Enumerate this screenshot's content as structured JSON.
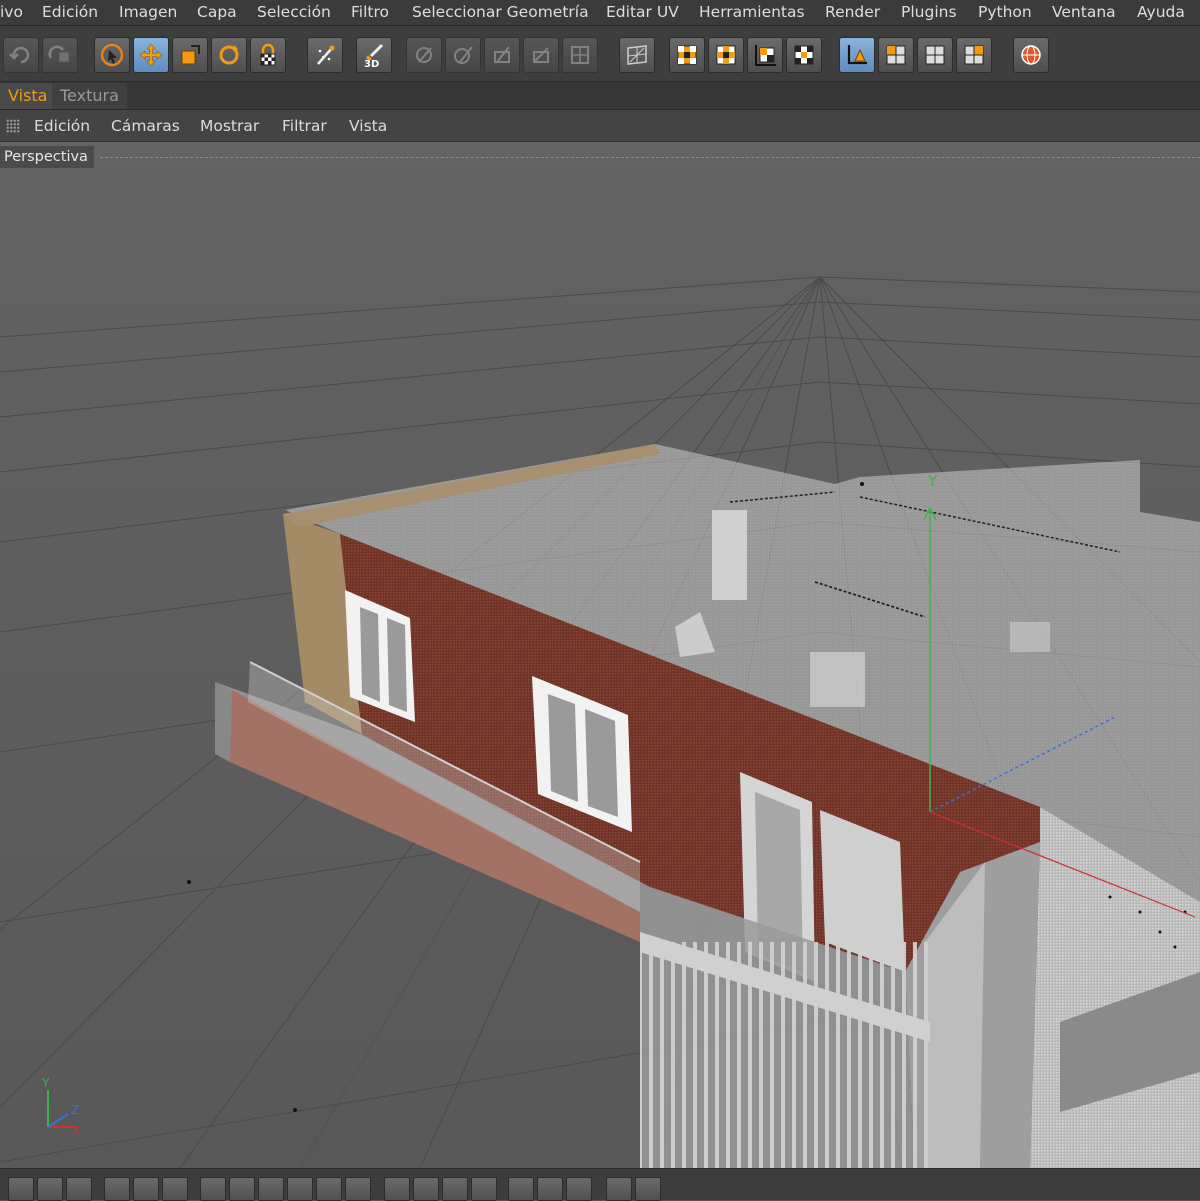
{
  "menubar": {
    "items": [
      "ivo",
      "Edición",
      "Imagen",
      "Capa",
      "Selección",
      "Filtro",
      "Seleccionar Geometría",
      "Editar UV",
      "Herramientas",
      "Render",
      "Plugins",
      "Python",
      "Ventana",
      "Ayuda"
    ]
  },
  "toolbar": {
    "tools": [
      {
        "icon": "undo-icon",
        "state": "disabled"
      },
      {
        "icon": "redo-icon",
        "state": "disabled"
      },
      {
        "icon": "live-selection-icon",
        "state": "normal"
      },
      {
        "icon": "move-icon",
        "state": "active"
      },
      {
        "icon": "scale-icon",
        "state": "normal"
      },
      {
        "icon": "rotate-icon",
        "state": "normal"
      },
      {
        "icon": "lock-icon",
        "state": "normal"
      },
      {
        "icon": "magic-wand-icon",
        "state": "normal"
      },
      {
        "icon": "3d-paint-icon",
        "state": "normal",
        "label": "3D"
      },
      {
        "icon": "brush-1-icon",
        "state": "disabled"
      },
      {
        "icon": "brush-2-icon",
        "state": "disabled"
      },
      {
        "icon": "brush-3-icon",
        "state": "disabled"
      },
      {
        "icon": "brush-4-icon",
        "state": "disabled"
      },
      {
        "icon": "brush-5-icon",
        "state": "disabled"
      },
      {
        "icon": "texture-grid-icon",
        "state": "normal"
      },
      {
        "icon": "checker-1-icon",
        "state": "normal"
      },
      {
        "icon": "checker-2-icon",
        "state": "normal"
      },
      {
        "icon": "axis-checker-icon",
        "state": "normal"
      },
      {
        "icon": "checker-3-icon",
        "state": "normal"
      },
      {
        "icon": "axis-mode-icon",
        "state": "active"
      },
      {
        "icon": "layout-1-icon",
        "state": "normal"
      },
      {
        "icon": "layout-2-icon",
        "state": "normal"
      },
      {
        "icon": "layout-3-icon",
        "state": "normal"
      },
      {
        "icon": "render-sphere-icon",
        "state": "normal"
      }
    ]
  },
  "tabs": [
    {
      "label": "Vista",
      "active": true
    },
    {
      "label": "Textura",
      "active": false
    }
  ],
  "view_menu": {
    "items": [
      "Edición",
      "Cámaras",
      "Mostrar",
      "Filtrar",
      "Vista"
    ]
  },
  "viewport": {
    "camera": "Perspectiva",
    "axis_labels": {
      "x": "X",
      "y": "Y",
      "z": "Z"
    },
    "gizmo_label": "Y"
  },
  "colors": {
    "accent": "#f39c12",
    "brick": "#7a3c2e",
    "axis_x": "#d03030",
    "axis_y": "#3cb44b",
    "axis_z": "#3a6fd8"
  }
}
